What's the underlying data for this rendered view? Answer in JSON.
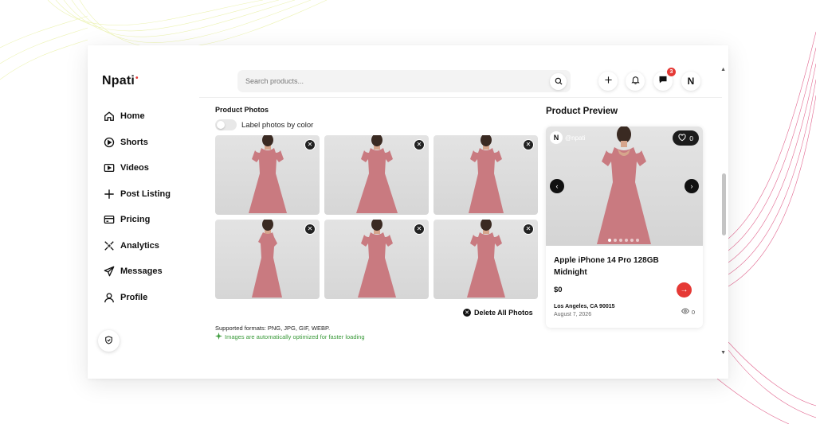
{
  "app": {
    "logo": "Npati",
    "logo_dot": "•"
  },
  "sidebar": {
    "items": [
      {
        "label": "Home",
        "icon": "home-icon"
      },
      {
        "label": "Shorts",
        "icon": "play-circle-icon"
      },
      {
        "label": "Videos",
        "icon": "video-icon"
      },
      {
        "label": "Post Listing",
        "icon": "plus-icon"
      },
      {
        "label": "Pricing",
        "icon": "card-icon"
      },
      {
        "label": "Analytics",
        "icon": "analytics-icon"
      },
      {
        "label": "Messages",
        "icon": "send-icon"
      },
      {
        "label": "Profile",
        "icon": "user-icon"
      }
    ],
    "bottom_icon": "shield-icon"
  },
  "header": {
    "search_placeholder": "Search products...",
    "messages_badge": "3",
    "avatar_initial": "N"
  },
  "photos": {
    "section_title": "Product Photos",
    "toggle_label": "Label photos by color",
    "toggle_on": false,
    "count": 6,
    "delete_all_label": "Delete All Photos",
    "formats_text": "Supported formats: PNG, JPG, GIF, WEBP.",
    "optimized_text": "Images are automatically optimized for faster loading"
  },
  "preview": {
    "title": "Product Preview",
    "seller_initial": "N",
    "seller_handle": "@npati",
    "likes": "0",
    "product_title": "Apple iPhone 14 Pro 128GB Midnight",
    "price": "$0",
    "location": "Los Angeles, CA 90015",
    "date": "August 7, 2026",
    "views": "0"
  },
  "colors": {
    "accent": "#e53935",
    "dress": "#c97a80",
    "success": "#3a9a3a"
  }
}
